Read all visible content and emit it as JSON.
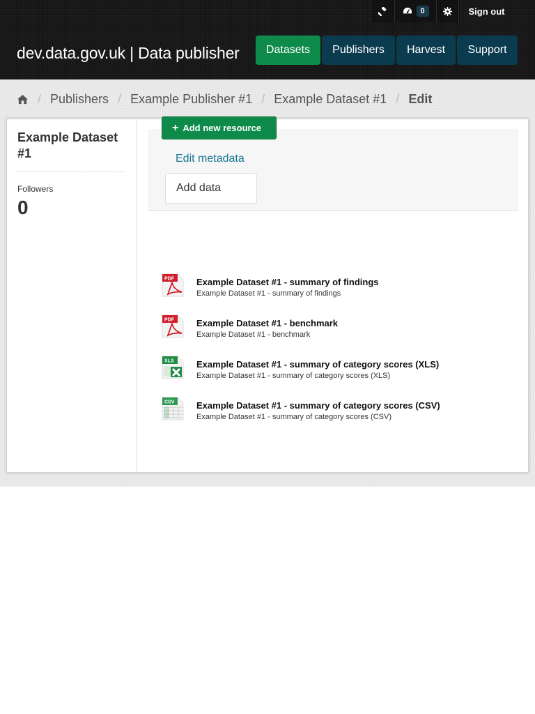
{
  "header": {
    "site_title": "dev.data.gov.uk | Data publisher",
    "account": {
      "sysadmin_icon": "gavel-icon",
      "dashboard_icon": "dashboard-icon",
      "notification_count": "0",
      "settings_icon": "cog-icon",
      "signout_label": "Sign out"
    },
    "nav": [
      {
        "label": "Datasets"
      },
      {
        "label": "Publishers"
      },
      {
        "label": "Harvest"
      },
      {
        "label": "Support"
      }
    ],
    "colors": {
      "active": "#0e8a4a",
      "nav": "#0b3b4f"
    }
  },
  "breadcrumb": [
    {
      "label": "Publishers"
    },
    {
      "label": "Example Publisher #1"
    },
    {
      "label": "Example Dataset #1"
    },
    {
      "label": "Edit"
    }
  ],
  "sidebar": {
    "title": "Example Dataset #1",
    "followers_label": "Followers",
    "followers_count": "0"
  },
  "tabs": {
    "edit_metadata": "Edit metadata",
    "add_data": "Add data"
  },
  "add_resource_label": "Add new resource",
  "resources": [
    {
      "format": "PDF",
      "icon": "pdf-file-icon",
      "title": "Example Dataset #1 - summary of findings",
      "description": "Example Dataset #1 - summary of findings"
    },
    {
      "format": "PDF",
      "icon": "pdf-file-icon",
      "title": "Example Dataset #1 - benchmark",
      "description": "Example Dataset #1 - benchmark"
    },
    {
      "format": "XLS",
      "icon": "xls-file-icon",
      "title": "Example Dataset #1 - summary of category scores (XLS)",
      "description": "Example Dataset #1 - summary of category scores (XLS)"
    },
    {
      "format": "CSV",
      "icon": "csv-file-icon",
      "title": "Example Dataset #1 - summary of category scores (CSV)",
      "description": "Example Dataset #1 - summary of category scores (CSV)"
    }
  ]
}
